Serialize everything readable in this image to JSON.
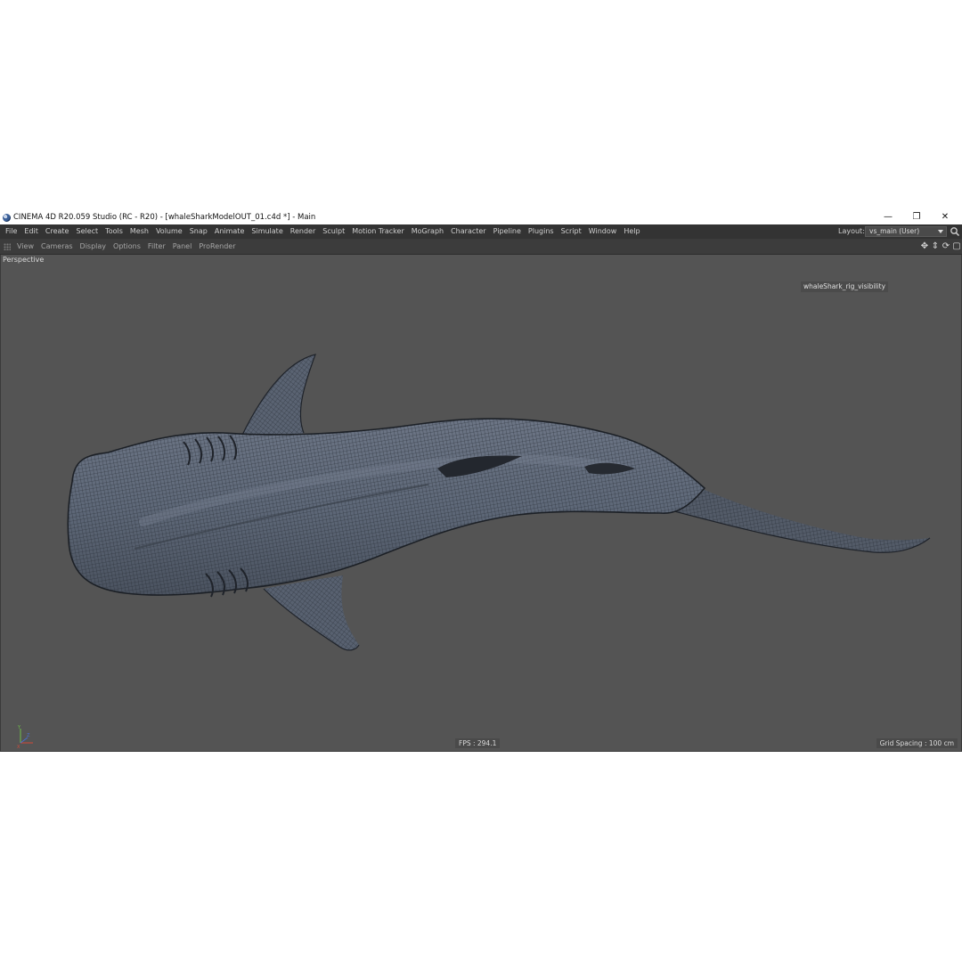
{
  "window": {
    "title": "CINEMA 4D R20.059 Studio (RC - R20) - [whaleSharkModelOUT_01.c4d *] - Main",
    "minimize_glyph": "—",
    "maximize_glyph": "❐",
    "close_glyph": "✕"
  },
  "menubar": {
    "items": [
      "File",
      "Edit",
      "Create",
      "Select",
      "Tools",
      "Mesh",
      "Volume",
      "Snap",
      "Animate",
      "Simulate",
      "Render",
      "Sculpt",
      "Motion Tracker",
      "MoGraph",
      "Character",
      "Pipeline",
      "Plugins",
      "Script",
      "Window",
      "Help"
    ],
    "layout_label": "Layout:",
    "layout_value": "vs_main (User)"
  },
  "viewport_menu": {
    "items": [
      "View",
      "Cameras",
      "Display",
      "Options",
      "Filter",
      "Panel",
      "ProRender"
    ],
    "nav_icons": [
      {
        "name": "move-view-icon",
        "glyph": "✥"
      },
      {
        "name": "zoom-view-icon",
        "glyph": "⇕"
      },
      {
        "name": "rotate-view-icon",
        "glyph": "⟳"
      },
      {
        "name": "toggle-view-icon",
        "glyph": "▢"
      }
    ]
  },
  "viewport": {
    "camera_label": "Perspective",
    "hud_tag": "whaleShark_rig_visibility",
    "fps": "FPS : 294.1",
    "grid_spacing": "Grid Spacing : 100 cm"
  },
  "colors": {
    "viewport_bg": "#545454",
    "mesh_fill": "#5b6472",
    "mesh_wire": "#262b33",
    "ui_dark": "#333333"
  }
}
